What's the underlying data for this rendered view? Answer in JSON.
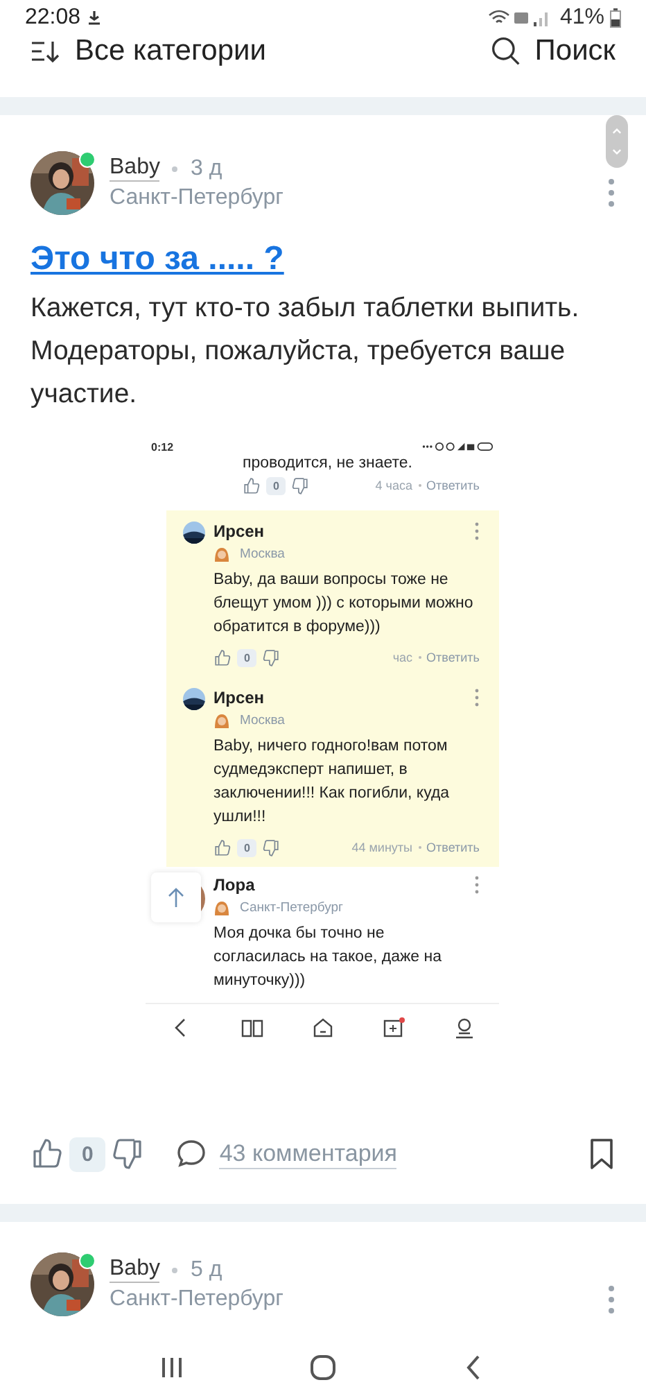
{
  "status_bar": {
    "time": "22:08",
    "battery": "41%"
  },
  "top_bar": {
    "filter_label": "Все категории",
    "search_label": "Поиск"
  },
  "posts": [
    {
      "author": "Baby",
      "online": true,
      "age": "3 д",
      "location": "Санкт-Петербург",
      "title": "Это что за ..... ?",
      "text": "Кажется, тут кто-то забыл таблетки выпить. Модераторы, пожалуйста, требуется ваше участие.",
      "embedded_screenshot": {
        "status_time": "0:12",
        "comments": [
          {
            "kind": "tail",
            "highlighted": false,
            "text": "проводится, не знаете.",
            "likes": "0",
            "time": "4 часа",
            "reply": "Ответить"
          },
          {
            "kind": "reply",
            "highlighted": true,
            "author": "Ирсен",
            "location": "Москва",
            "text": "Baby, да ваши вопросы тоже не блещут умом ))) с которыми можно обратится в форуме)))",
            "likes": "0",
            "time": "час",
            "reply": "Ответить"
          },
          {
            "kind": "reply",
            "highlighted": true,
            "author": "Ирсен",
            "location": "Москва",
            "text": "Baby, ничего годного!вам потом судмедэксперт напишет, в заключении!!! Как погибли, куда ушли!!!",
            "likes": "0",
            "time": "44 минуты",
            "reply": "Ответить"
          },
          {
            "kind": "comment",
            "highlighted": false,
            "author": "Лора",
            "location": "Санкт-Петербург",
            "text": "Моя дочка бы точно не согласилась на такое, даже на минуточку)))"
          }
        ]
      },
      "likes": "0",
      "comments": "43 комментария"
    },
    {
      "author": "Baby",
      "online": true,
      "age": "5 д",
      "location": "Санкт-Петербург"
    }
  ]
}
